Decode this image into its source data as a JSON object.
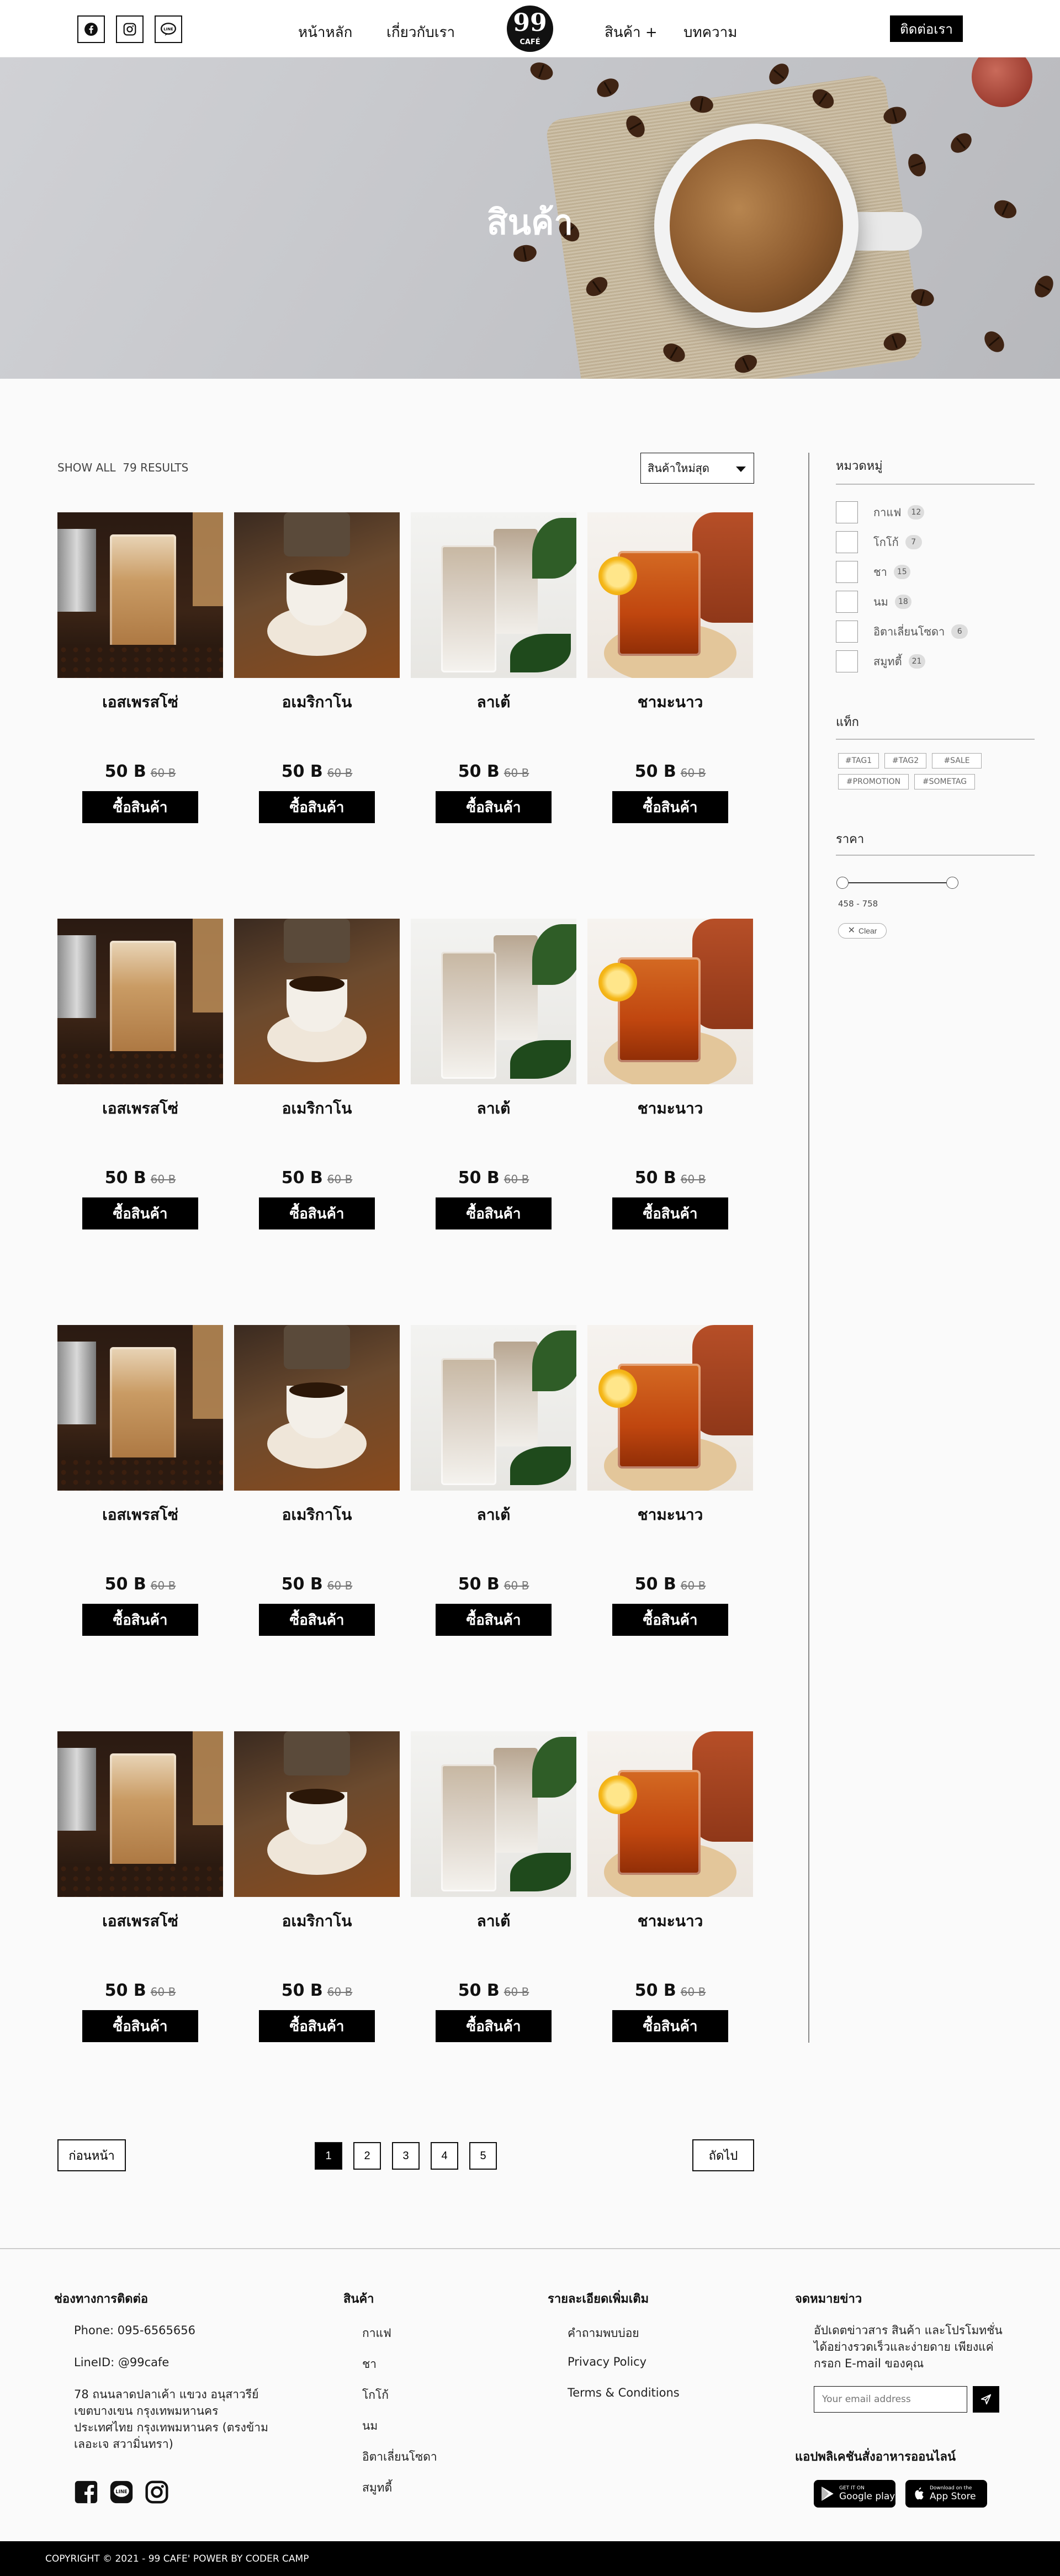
{
  "header": {
    "social": [
      {
        "name": "facebook-icon"
      },
      {
        "name": "instagram-icon"
      },
      {
        "name": "line-icon"
      }
    ],
    "nav_left": [
      "หน้าหลัก",
      "เกี่ยวกับเรา"
    ],
    "logo_number": "99",
    "logo_text": "CAFÉ",
    "nav_right": [
      "สินค้า +",
      "บทความ"
    ],
    "contact_label": "ติดต่อเรา"
  },
  "hero": {
    "title": "สินค้า"
  },
  "toolbar": {
    "results_text": "SHOW ALL  79 RESULTS",
    "sort_value": "สินค้าใหม่สุด"
  },
  "products": {
    "price_now": "50 B",
    "price_old": "60 B",
    "buy_label": "ซื้อสินค้า",
    "items": [
      {
        "name": "เอสเพรสโซ่"
      },
      {
        "name": "อเมริกาโน"
      },
      {
        "name": "ลาเต้"
      },
      {
        "name": "ชามะนาว"
      }
    ]
  },
  "sidebar": {
    "categories_title": "หมวดหมู่",
    "categories": [
      {
        "label": "กาแฟ",
        "count": "12"
      },
      {
        "label": "โกโก้",
        "count": "7"
      },
      {
        "label": "ชา",
        "count": "15"
      },
      {
        "label": "นม",
        "count": "18"
      },
      {
        "label": "อิตาเลี่ยนโซดา",
        "count": "6"
      },
      {
        "label": "สมูทตี้",
        "count": "21"
      }
    ],
    "tags_title": "แท็ก",
    "tags": [
      "#TAG1",
      "#TAG2",
      "#SALE",
      "#PROMOTION",
      "#SOMETAG"
    ],
    "price_title": "ราคา",
    "price_range": "458 - 758",
    "clear_label": "Clear"
  },
  "pagination": {
    "prev_label": "ก่อนหน้า",
    "next_label": "ถัดไป",
    "pages": [
      "1",
      "2",
      "3",
      "4",
      "5"
    ],
    "current": "1"
  },
  "footer": {
    "contact_title": "ช่องทางการติดต่อ",
    "phone": "Phone: 095-6565656",
    "line": "LineID: @99cafe",
    "address": "78 ถนนลาดปลาเค้า แขวง อนุสาวรีย์ เขตบางเขน กรุงเทพมหานคร ประเทศไทย กรุงเทพมหานคร (ตรงข้ามเลอะเจ สวามิ่นทรา)",
    "products_title": "สินค้า",
    "products_links": [
      "กาแฟ",
      "ชา",
      "โกโก้",
      "นม",
      "อิตาเลี่ยนโซดา",
      "สมูทตี้"
    ],
    "info_title": "รายละเอียดเพิ่มเติม",
    "info_links": [
      "คำถามพบบ่อย",
      "Privacy Policy",
      "Terms & Conditions"
    ],
    "newsletter_title": "จดหมายข่าว",
    "newsletter_text": "อัปเดตข่าวสาร สินค้า และโปรโมทชั่นได้อย่างรวดเร็วและง่ายดาย เพียงแค่กรอก E-mail ของคุณ",
    "email_placeholder": "Your email address",
    "app_title": "แอปพลิเคชันสั่งอาหารออนไลน์",
    "google_small": "GET IT ON",
    "google_big": "Google play",
    "apple_small": "Download on the",
    "apple_big": "App Store"
  },
  "copyright": "COPYRIGHT © 2021 - 99 CAFE' POWER BY CODER CAMP"
}
